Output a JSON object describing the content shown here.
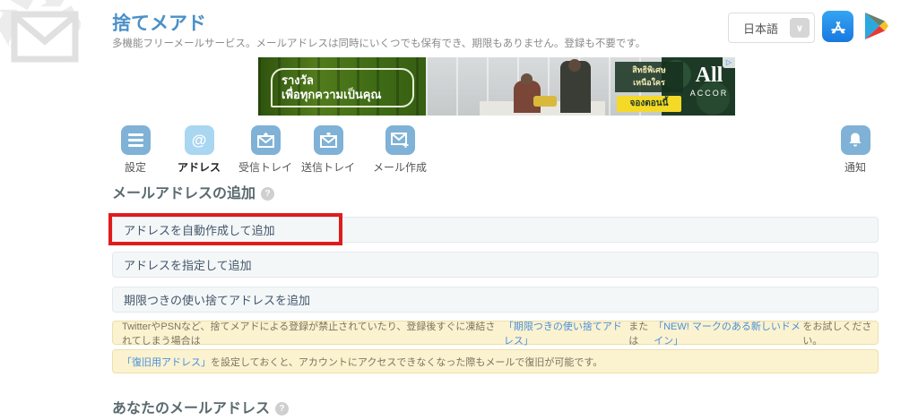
{
  "app": {
    "title": "捨てメアド",
    "subtitle": "多機能フリーメールサービス。メールアドレスは同時にいくつでも保有でき、期限もありません。登録も不要です。"
  },
  "header": {
    "language_selected": "日本語",
    "chevron": "∨",
    "appstore_icon": "app-store",
    "gplay_icon": "google-play"
  },
  "ad": {
    "left_line1": "รางวัล",
    "left_line2": "เพื่อทุกความเป็นคุณ",
    "promo_line1": "สิทธิพิเศษ",
    "promo_line2": "เหนือใคร",
    "cta": "จองตอนนี้",
    "brand_main": "All",
    "brand_sub": "ACCOR",
    "adchoices": "▷"
  },
  "nav": {
    "items": [
      {
        "label": "設定",
        "icon": "menu-icon",
        "active": false
      },
      {
        "label": "アドレス",
        "icon": "at-icon",
        "active": true,
        "glyph": "@"
      },
      {
        "label": "受信トレイ",
        "icon": "inbox-icon",
        "active": false
      },
      {
        "label": "送信トレイ",
        "icon": "sent-icon",
        "active": false
      },
      {
        "label": "メール作成",
        "icon": "compose-icon",
        "active": false
      }
    ],
    "notification": {
      "label": "通知",
      "icon": "bell-icon"
    }
  },
  "sections": {
    "add_heading": "メールアドレスの追加",
    "help_glyph": "?",
    "buttons": [
      "アドレスを自動作成して追加",
      "アドレスを指定して追加",
      "期限つきの使い捨てアドレスを追加"
    ],
    "notice1": {
      "pre": "TwitterやPSNなど、捨てメアドによる登録が禁止されていたり、登録後すぐに凍結されてしまう場合は",
      "link1": "「期限つきの使い捨てアドレス」",
      "mid": "または",
      "link2": "「NEW! マークのある新しいドメイン」",
      "post": "をお試しください。"
    },
    "notice2": {
      "link": "「復旧用アドレス」",
      "text": "を設定しておくと、アカウントにアクセスできなくなった際もメールで復旧が可能です。"
    },
    "your_heading": "あなたのメールアドレス"
  },
  "colors": {
    "title_blue": "#4a90c8",
    "nav_inactive": "#7fb2d6",
    "nav_active": "#a9d6f1",
    "panel_bg": "#f4f7f8",
    "notice_bg": "#fbf2d0",
    "link_blue": "#4a90d9",
    "annotation_red": "#e01b1b"
  }
}
